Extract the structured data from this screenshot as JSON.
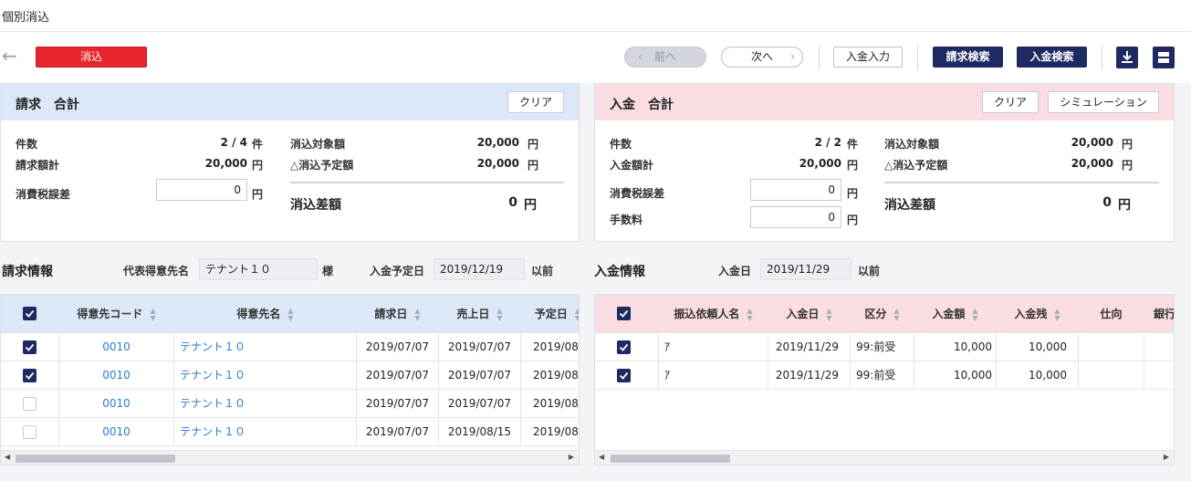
{
  "title": "個別消込",
  "toolbar": {
    "reconcile_label": "消込",
    "prev_label": "前へ",
    "next_label": "次へ",
    "payment_input_label": "入金入力",
    "invoice_search_label": "請求検索",
    "payment_search_label": "入金検索"
  },
  "invoice_summary": {
    "title": "請求　合計",
    "clear_label": "クリア",
    "count_label": "件数",
    "count_value": "2 / 4",
    "count_unit": "件",
    "total_label": "請求額計",
    "total_value": "20,000",
    "total_unit": "円",
    "tax_diff_label": "消費税誤差",
    "tax_diff_value": "0",
    "tax_diff_unit": "円",
    "target_label": "消込対象額",
    "target_value": "20,000",
    "target_unit": "円",
    "planned_label": "△消込予定額",
    "planned_value": "20,000",
    "planned_unit": "円",
    "diff_label": "消込差額",
    "diff_value": "0",
    "diff_unit": "円"
  },
  "payment_summary": {
    "title": "入金　合計",
    "clear_label": "クリア",
    "simulation_label": "シミュレーション",
    "count_label": "件数",
    "count_value": "2 / 2",
    "count_unit": "件",
    "total_label": "入金額計",
    "total_value": "20,000",
    "total_unit": "円",
    "tax_diff_label": "消費税誤差",
    "tax_diff_value": "0",
    "tax_diff_unit": "円",
    "fee_label": "手数料",
    "fee_value": "0",
    "fee_unit": "円",
    "target_label": "消込対象額",
    "target_value": "20,000",
    "target_unit": "円",
    "planned_label": "△消込予定額",
    "planned_value": "20,000",
    "planned_unit": "円",
    "diff_label": "消込差額",
    "diff_value": "0",
    "diff_unit": "円"
  },
  "invoice_info": {
    "title": "請求情報",
    "rep_customer_label": "代表得意先名",
    "rep_customer_value": "テナント１０",
    "honorific": "様",
    "due_label": "入金予定日",
    "due_value": "2019/12/19",
    "due_suffix": "以前",
    "columns": [
      "得意先コード",
      "得意先名",
      "請求日",
      "売上日",
      "予定日"
    ],
    "rows": [
      {
        "checked": true,
        "code": "0010",
        "name": "テナント１０",
        "invoice_date": "2019/07/07",
        "sales_date": "2019/07/07",
        "due_date": "2019/08/"
      },
      {
        "checked": true,
        "code": "0010",
        "name": "テナント１０",
        "invoice_date": "2019/07/07",
        "sales_date": "2019/07/07",
        "due_date": "2019/08/"
      },
      {
        "checked": false,
        "code": "0010",
        "name": "テナント１０",
        "invoice_date": "2019/07/07",
        "sales_date": "2019/07/07",
        "due_date": "2019/08/"
      },
      {
        "checked": false,
        "code": "0010",
        "name": "テナント１０",
        "invoice_date": "2019/07/07",
        "sales_date": "2019/08/15",
        "due_date": "2019/08/"
      }
    ]
  },
  "payment_info": {
    "title": "入金情報",
    "date_label": "入金日",
    "date_value": "2019/11/29",
    "date_suffix": "以前",
    "columns": [
      "振込依頼人名",
      "入金日",
      "区分",
      "入金額",
      "入金残",
      "仕向",
      "銀行"
    ],
    "rows": [
      {
        "checked": true,
        "payer": "ｱ",
        "date": "2019/11/29",
        "kind": "99:前受",
        "amount": "10,000",
        "remaining": "10,000",
        "dest": "",
        "bank": ""
      },
      {
        "checked": true,
        "payer": "ｱ",
        "date": "2019/11/29",
        "kind": "99:前受",
        "amount": "10,000",
        "remaining": "10,000",
        "dest": "",
        "bank": ""
      }
    ]
  },
  "colors": {
    "navy": "#1f2a63",
    "red": "#e8242c",
    "invoice_header": "#dce8f7",
    "payment_header": "#f9dde1",
    "link": "#2a7bd0"
  }
}
